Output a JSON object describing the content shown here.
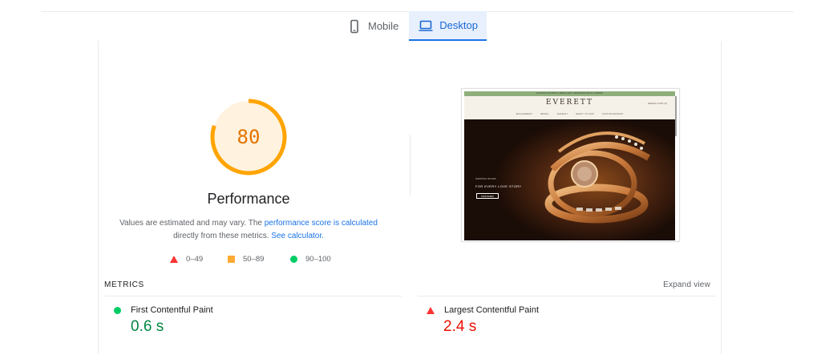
{
  "tabs": [
    {
      "label": "Mobile",
      "icon": "phone-icon",
      "active": false
    },
    {
      "label": "Desktop",
      "icon": "laptop-icon",
      "active": true
    }
  ],
  "performance": {
    "score": "80",
    "score_fraction": 0.8,
    "score_color": "#ffa400",
    "title": "Performance",
    "desc_text_1": "Values are estimated and may vary. The ",
    "desc_link_1": "performance score is calculated",
    "desc_text_2": "directly from these metrics. ",
    "desc_link_2": "See calculator."
  },
  "legend": [
    {
      "shape": "triangle",
      "color": "#ff3333",
      "label": "0–49"
    },
    {
      "shape": "square",
      "color": "#ffaa33",
      "label": "50–89"
    },
    {
      "shape": "circle",
      "color": "#00cc66",
      "label": "90–100"
    }
  ],
  "screenshot": {
    "announcement": "CLASSIC & ETHICAL JEWELLERY HANDCRAFTED IN LONDON",
    "logo": "EVERETT",
    "account": "SEARCH   CART (0)",
    "nav": [
      "ENGAGEMENT",
      "BRIDAL",
      "JEWELRY",
      "READY TO SHIP",
      "CUSTOM DESIGNS"
    ],
    "hero_eyebrow": "WEDDING BANDS",
    "hero_title": "FOR EVERY LOVE STORY",
    "hero_button": "SHOP BANDS"
  },
  "metrics": {
    "label": "METRICS",
    "expand": "Expand view",
    "items": [
      {
        "name": "First Contentful Paint",
        "value": "0.6 s",
        "rating": "good",
        "color": "#0c6"
      },
      {
        "name": "Largest Contentful Paint",
        "value": "2.4 s",
        "rating": "bad",
        "color": "#f33"
      }
    ]
  }
}
